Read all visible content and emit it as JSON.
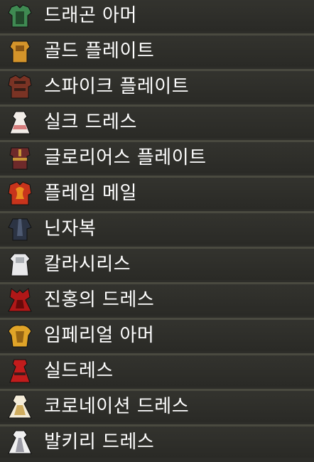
{
  "items": [
    {
      "label": "드래곤 아머",
      "icon": "dragon-armor-icon",
      "color": "#3f8a52",
      "accent": "#1f3d26"
    },
    {
      "label": "골드 플레이트",
      "icon": "gold-plate-icon",
      "color": "#d4942a",
      "accent": "#7a4a10"
    },
    {
      "label": "스파이크 플레이트",
      "icon": "spike-plate-icon",
      "color": "#7a3324",
      "accent": "#2a1a14"
    },
    {
      "label": "실크 드레스",
      "icon": "silk-dress-icon",
      "color": "#f2ede8",
      "accent": "#d26a6a"
    },
    {
      "label": "글로리어스 플레이트",
      "icon": "glorious-plate-icon",
      "color": "#6e2a2a",
      "accent": "#d8a83a"
    },
    {
      "label": "플레임 메일",
      "icon": "flame-mail-icon",
      "color": "#c8341c",
      "accent": "#f0a020"
    },
    {
      "label": "닌자복",
      "icon": "ninja-suit-icon",
      "color": "#2c3444",
      "accent": "#55627a"
    },
    {
      "label": "칼라시리스",
      "icon": "kalasiris-icon",
      "color": "#e8e8ea",
      "accent": "#a0a4aa"
    },
    {
      "label": "진홍의 드레스",
      "icon": "crimson-dress-icon",
      "color": "#b01818",
      "accent": "#5a0808"
    },
    {
      "label": "임페리얼 아머",
      "icon": "imperial-armor-icon",
      "color": "#e0a428",
      "accent": "#8a5a10"
    },
    {
      "label": "실드레스",
      "icon": "seal-dress-icon",
      "color": "#c21c1c",
      "accent": "#2a1a1a"
    },
    {
      "label": "코로네이션 드레스",
      "icon": "coronation-dress-icon",
      "color": "#f4ecd8",
      "accent": "#c9a24a"
    },
    {
      "label": "발키리 드레스",
      "icon": "valkyrie-dress-icon",
      "color": "#f0f0f0",
      "accent": "#8e8e9a"
    }
  ]
}
